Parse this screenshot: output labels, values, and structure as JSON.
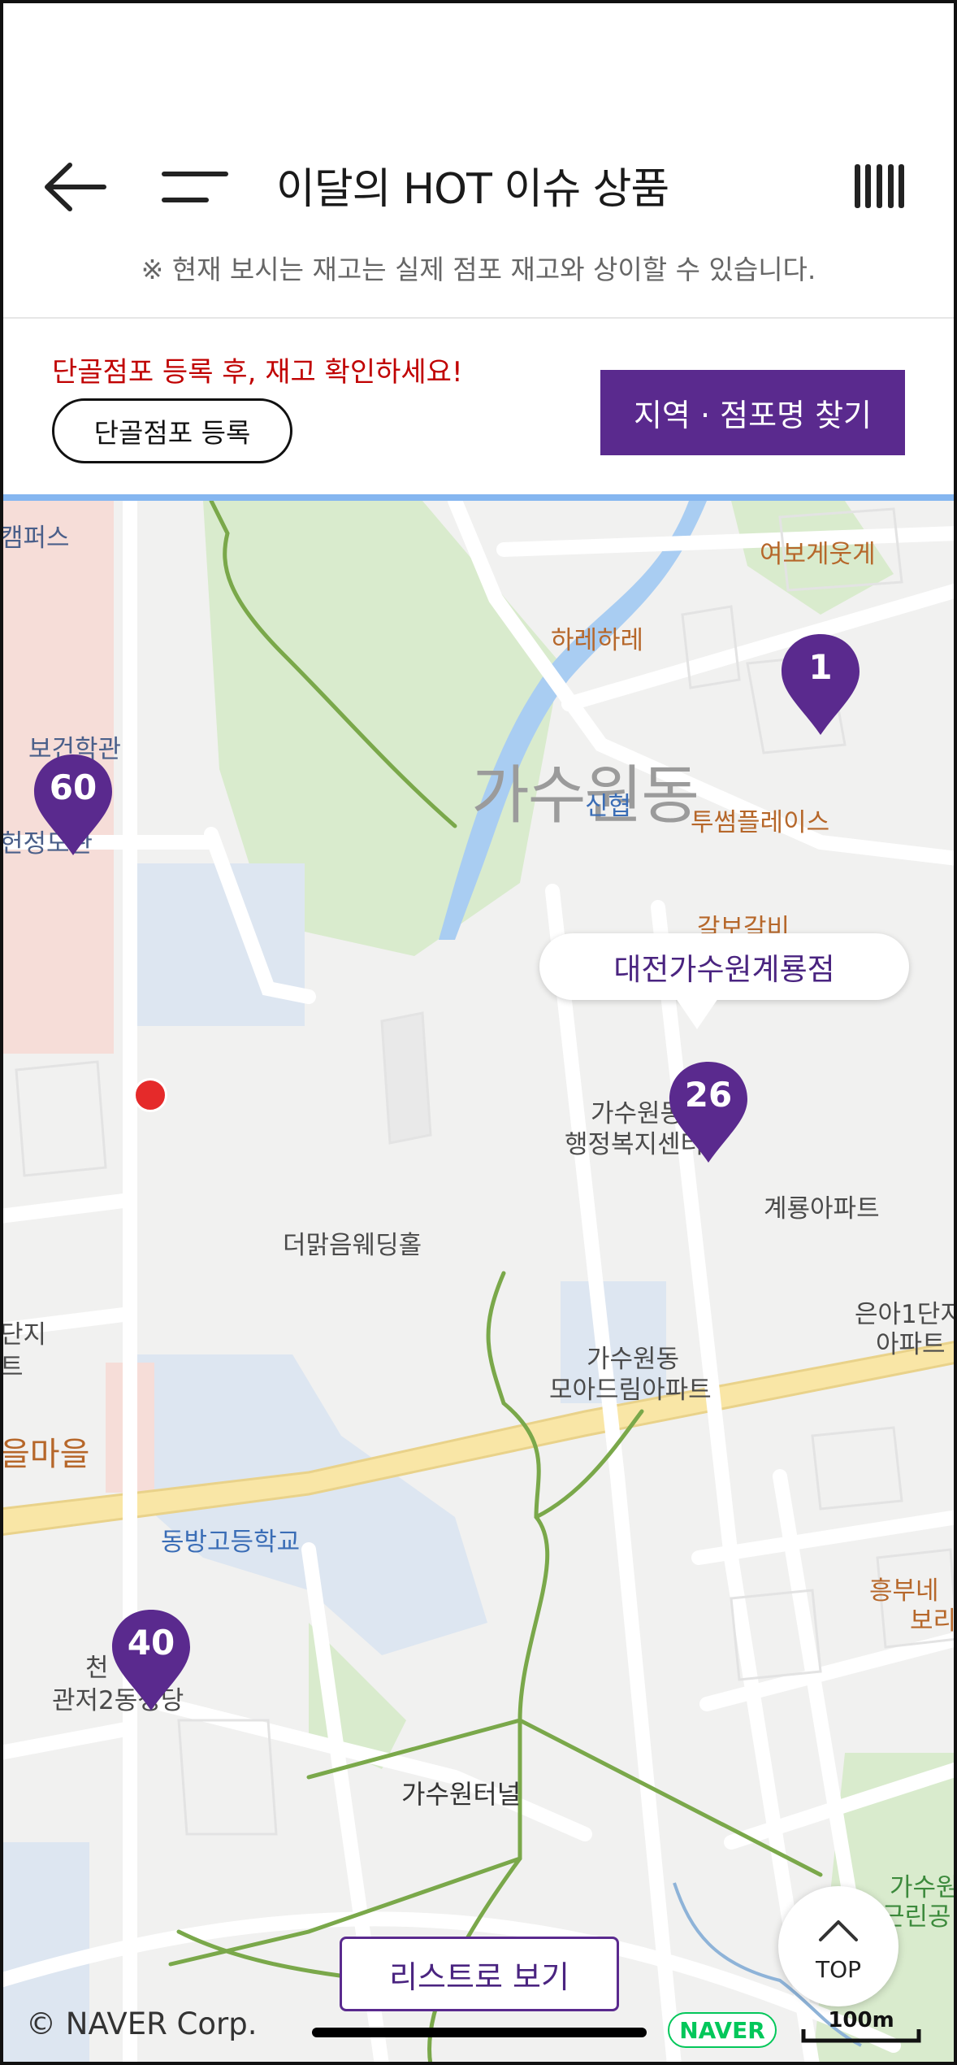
{
  "header": {
    "title": "이달의 HOT 이슈 상품",
    "notice": "※ 현재 보시는 재고는 실제 점포 재고와 상이할 수 있습니다."
  },
  "store_bar": {
    "register_prompt": "단골점포 등록 후, 재고 확인하세요!",
    "register_button": "단골점포 등록",
    "find_button": "지역 · 점포명 찾기"
  },
  "map": {
    "district": "가수원동",
    "selected_store": "대전가수원계룡점",
    "pins": [
      {
        "count": "1"
      },
      {
        "count": "60"
      },
      {
        "count": "26"
      },
      {
        "count": "40"
      }
    ],
    "labels": {
      "yeobo": "여보게웃게",
      "hare": "하레하레",
      "campus": "캠퍼스",
      "health_hall": "보건학관",
      "hyeonjeong": "헌정도관",
      "shinhyeop": "신협",
      "twosome": "투썸플레이스",
      "galbi": "갈보갈비",
      "admin": "가수원동",
      "admin2": "행정복지센터",
      "gyeryong": "계룡아파트",
      "wedding": "더맑음웨딩홀",
      "eunah": "은아1단지",
      "eunah2": "아파트",
      "moa": "가수원동",
      "moa2": "모아드림아파트",
      "danji": "단지",
      "danji2": "트",
      "maeul": "을마을",
      "dongbang": "동방고등학교",
      "heungbu": "흥부네",
      "heungbu2": "보리",
      "cheon": "천",
      "gwanjeo": "관저2동성당",
      "tunnel": "가수원터널",
      "park": "가수원",
      "park2": "근린공"
    }
  },
  "controls": {
    "list_button": "리스트로 보기",
    "top_button": "TOP",
    "copyright": "© NAVER Corp.",
    "naver_logo": "NAVER",
    "scale": "100m"
  },
  "colors": {
    "brand_purple": "#5a2a8e",
    "alert_red": "#c00000",
    "naver_green": "#03c75a"
  }
}
